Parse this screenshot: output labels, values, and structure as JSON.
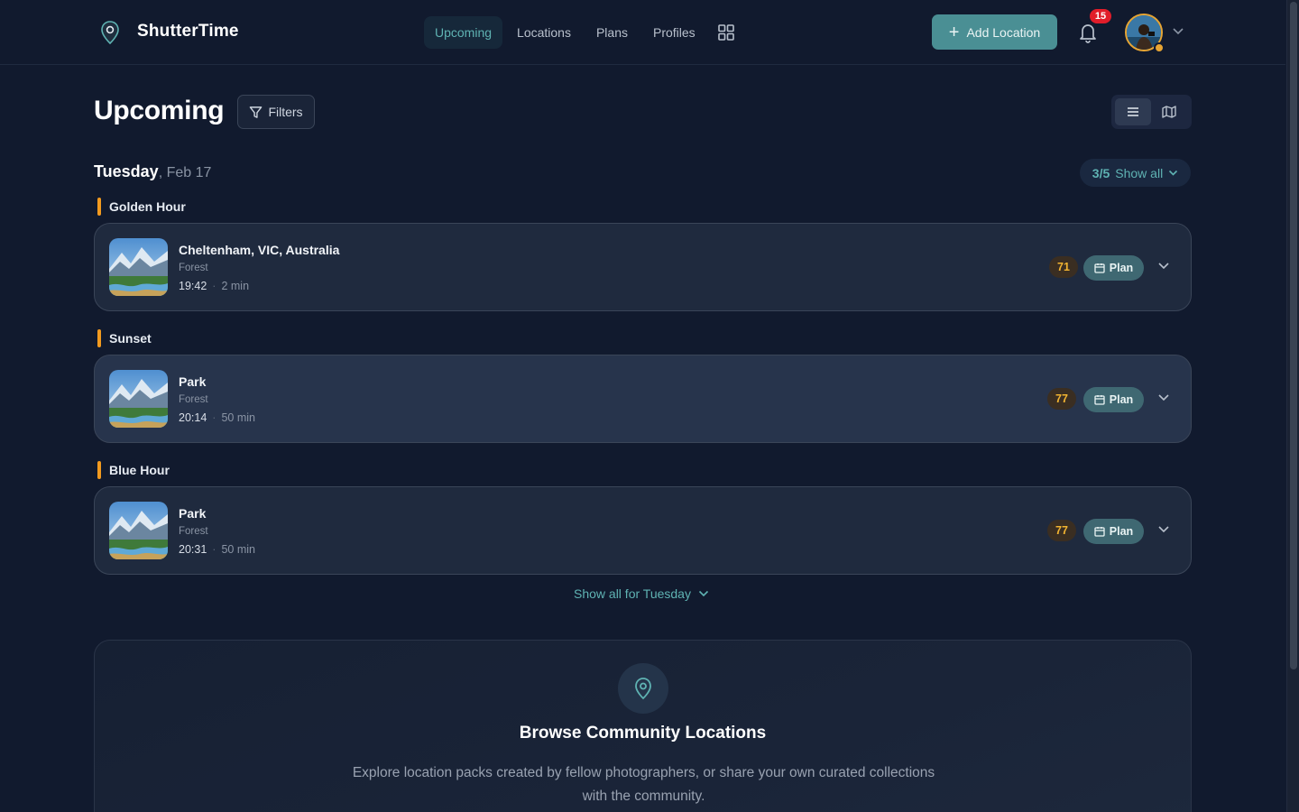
{
  "app": {
    "brand": "ShutterTime"
  },
  "nav": {
    "items": [
      {
        "label": "Upcoming",
        "active": true
      },
      {
        "label": "Locations",
        "active": false
      },
      {
        "label": "Plans",
        "active": false
      },
      {
        "label": "Profiles",
        "active": false
      }
    ],
    "more_icon": "grid-icon"
  },
  "header": {
    "add_label": "Add Location",
    "notifications_count": "15",
    "avatar_icon": "user-avatar"
  },
  "page": {
    "title": "Upcoming",
    "filters_label": "Filters",
    "view_modes": [
      "list-icon",
      "map-icon"
    ],
    "active_view": "list"
  },
  "day": {
    "weekday": "Tuesday",
    "date": ", Feb 17",
    "count": "3/5",
    "show_all_label": "Show all"
  },
  "sections": [
    {
      "label": "Golden Hour",
      "item": {
        "title": "Cheltenham, VIC, Australia",
        "type": "Forest",
        "time": "19:42",
        "duration": "2 min",
        "score": "71",
        "plan_label": "Plan"
      }
    },
    {
      "label": "Sunset",
      "item": {
        "title": "Park",
        "type": "Forest",
        "time": "20:14",
        "duration": "50 min",
        "score": "77",
        "plan_label": "Plan"
      }
    },
    {
      "label": "Blue Hour",
      "item": {
        "title": "Park",
        "type": "Forest",
        "time": "20:31",
        "duration": "50 min",
        "score": "77",
        "plan_label": "Plan"
      }
    }
  ],
  "show_all_day": "Show all for Tuesday",
  "community": {
    "title": "Browse Community Locations",
    "description": "Explore location packs created by fellow photographers, or share your own curated collections with the community."
  },
  "colors": {
    "background": "#111a2e",
    "accent": "#5fb3b3",
    "primary_button": "#4a8f94",
    "section_marker": "#f29a1f",
    "score_text": "#f2b431",
    "badge": "#e11d2a"
  }
}
